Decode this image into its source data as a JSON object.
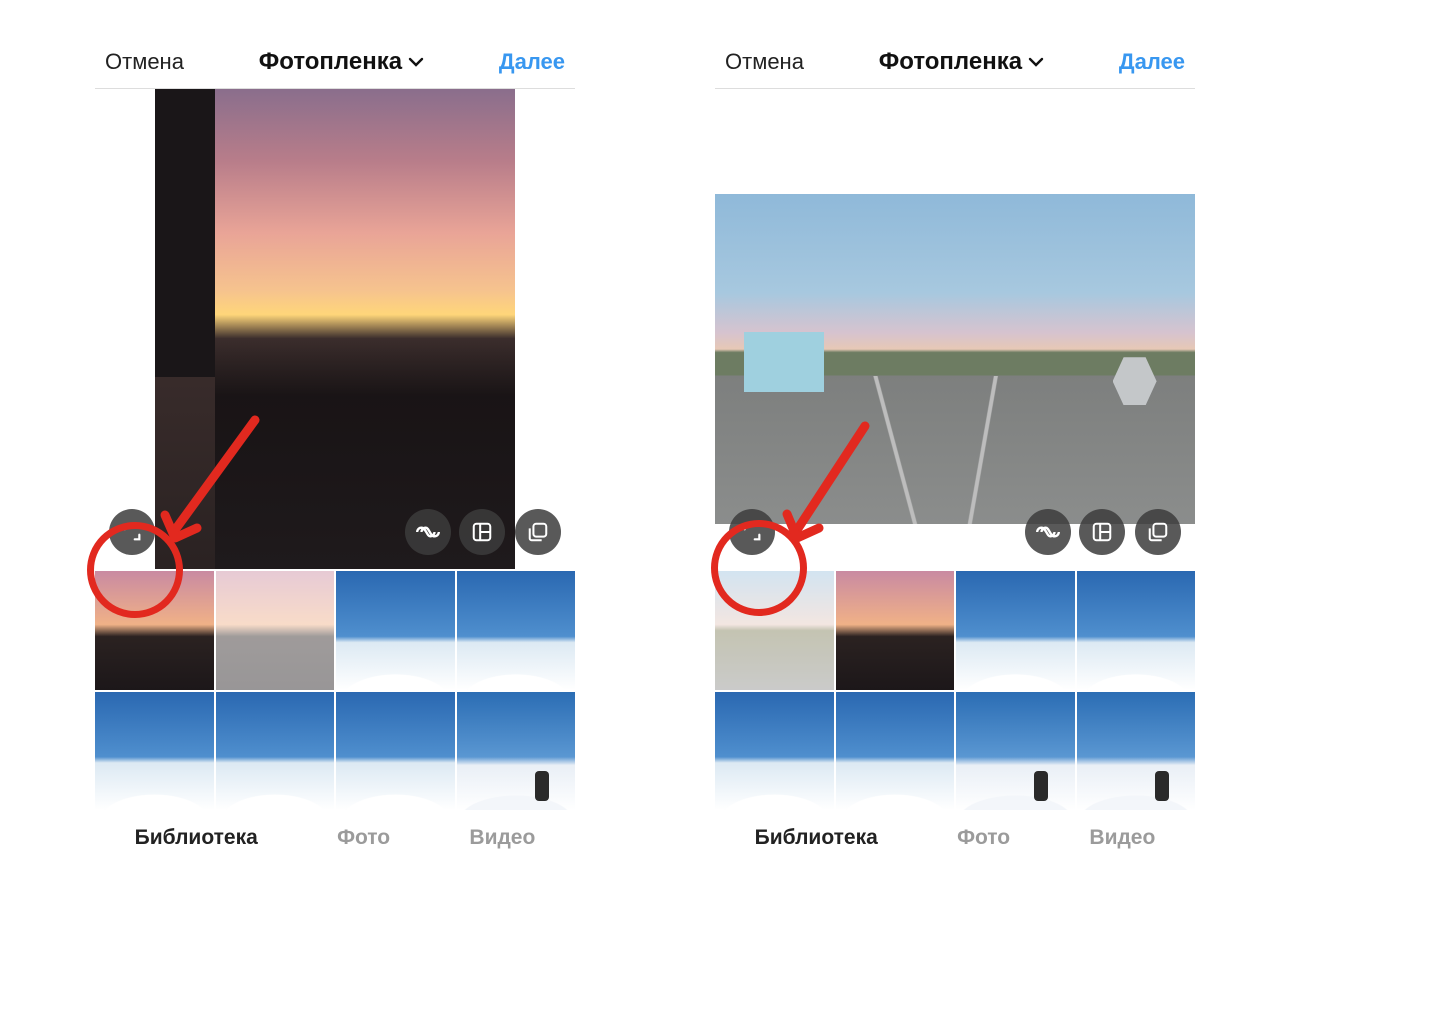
{
  "colors": {
    "accent": "#3897f0",
    "annotation": "#e2291f"
  },
  "screens": {
    "left": {
      "nav": {
        "cancel": "Отмена",
        "title": "Фотопленка",
        "next": "Далее"
      },
      "preview": {
        "photo_desc": "sunset-over-town-portrait",
        "buttons": {
          "expand": "expand-icon",
          "boomerang": "infinity-icon",
          "layout": "layout-icon",
          "multi": "multi-select-icon"
        }
      },
      "thumbs": [
        {
          "desc": "sunset-1",
          "selected": false,
          "kind": "t-sunset"
        },
        {
          "desc": "sunset-2-selected",
          "selected": true,
          "kind": "t-sunset"
        },
        {
          "desc": "mountain-1",
          "selected": false,
          "kind": "t-mtn"
        },
        {
          "desc": "mountain-2",
          "selected": false,
          "kind": "t-mtn"
        },
        {
          "desc": "mountain-3",
          "selected": false,
          "kind": "t-mtn"
        },
        {
          "desc": "mountain-4",
          "selected": false,
          "kind": "t-mtn"
        },
        {
          "desc": "mountain-5",
          "selected": false,
          "kind": "t-mtn"
        },
        {
          "desc": "skier-1",
          "selected": false,
          "kind": "t-ski"
        }
      ],
      "tabs": {
        "library": "Библиотека",
        "photo": "Фото",
        "video": "Видео",
        "active": "library"
      },
      "annotation": {
        "target": "expand-button"
      }
    },
    "right": {
      "nav": {
        "cancel": "Отмена",
        "title": "Фотопленка",
        "next": "Далее"
      },
      "preview": {
        "photo_desc": "coastal-road-landscape",
        "buttons": {
          "expand": "expand-icon",
          "boomerang": "infinity-icon",
          "layout": "layout-icon",
          "multi": "multi-select-icon"
        }
      },
      "thumbs": [
        {
          "desc": "coastal-road-selected",
          "selected": true,
          "kind": "t-road"
        },
        {
          "desc": "sunset-2",
          "selected": false,
          "kind": "t-sunset"
        },
        {
          "desc": "mountain-1",
          "selected": false,
          "kind": "t-mtn"
        },
        {
          "desc": "mountain-2",
          "selected": false,
          "kind": "t-mtn"
        },
        {
          "desc": "mountain-3",
          "selected": false,
          "kind": "t-mtn"
        },
        {
          "desc": "mountain-4",
          "selected": false,
          "kind": "t-mtn"
        },
        {
          "desc": "skier-1",
          "selected": false,
          "kind": "t-ski"
        },
        {
          "desc": "skier-2",
          "selected": false,
          "kind": "t-ski"
        }
      ],
      "tabs": {
        "library": "Библиотека",
        "photo": "Фото",
        "video": "Видео",
        "active": "library"
      },
      "annotation": {
        "target": "expand-button"
      }
    }
  }
}
